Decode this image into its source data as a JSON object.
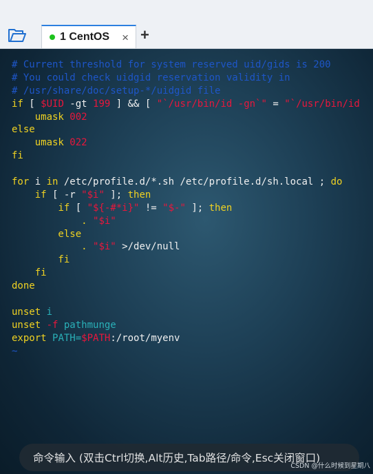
{
  "tabs": [
    {
      "index": "1",
      "label": "CentOS",
      "close": "×"
    }
  ],
  "new_tab_label": "+",
  "colors": {
    "comment": "#1e56c8",
    "keyword": "#f0d222",
    "variable": "#e8173c",
    "string": "#e8173c",
    "command": "#2ab0b8",
    "text": "#f0f0f0",
    "option": "#f0f0f0",
    "active_dot": "#1dc21d"
  },
  "terminal_lines": [
    [
      {
        "t": "# Current threshold for system reserved uid/gids is 200",
        "c": "comment"
      }
    ],
    [
      {
        "t": "# You could check uidgid reservation validity in",
        "c": "comment"
      }
    ],
    [
      {
        "t": "# /usr/share/doc/setup-*/uidgid file",
        "c": "comment"
      }
    ],
    [
      {
        "t": "if",
        "c": "keyword"
      },
      {
        "t": " [ ",
        "c": "text"
      },
      {
        "t": "$UID",
        "c": "variable"
      },
      {
        "t": " -gt ",
        "c": "text"
      },
      {
        "t": "199",
        "c": "variable"
      },
      {
        "t": " ] && [ ",
        "c": "text"
      },
      {
        "t": "\"`/usr/bin/id -gn`\"",
        "c": "string"
      },
      {
        "t": " = ",
        "c": "text"
      },
      {
        "t": "\"`/usr/bin/id",
        "c": "string"
      }
    ],
    [
      {
        "t": "    umask ",
        "c": "keyword"
      },
      {
        "t": "002",
        "c": "variable"
      }
    ],
    [
      {
        "t": "else",
        "c": "keyword"
      }
    ],
    [
      {
        "t": "    umask ",
        "c": "keyword"
      },
      {
        "t": "022",
        "c": "variable"
      }
    ],
    [
      {
        "t": "fi",
        "c": "keyword"
      }
    ],
    [],
    [
      {
        "t": "for",
        "c": "keyword"
      },
      {
        "t": " i ",
        "c": "text"
      },
      {
        "t": "in",
        "c": "keyword"
      },
      {
        "t": " /etc/profile.d/*.sh /etc/profile.d/sh.local ; ",
        "c": "text"
      },
      {
        "t": "do",
        "c": "keyword"
      }
    ],
    [
      {
        "t": "    ",
        "c": "text"
      },
      {
        "t": "if",
        "c": "keyword"
      },
      {
        "t": " [ -r ",
        "c": "text"
      },
      {
        "t": "\"$i\"",
        "c": "string"
      },
      {
        "t": " ]; ",
        "c": "text"
      },
      {
        "t": "then",
        "c": "keyword"
      }
    ],
    [
      {
        "t": "        ",
        "c": "text"
      },
      {
        "t": "if",
        "c": "keyword"
      },
      {
        "t": " [ ",
        "c": "text"
      },
      {
        "t": "\"${-#*i}\"",
        "c": "string"
      },
      {
        "t": " != ",
        "c": "text"
      },
      {
        "t": "\"$-\"",
        "c": "string"
      },
      {
        "t": " ]; ",
        "c": "text"
      },
      {
        "t": "then",
        "c": "keyword"
      }
    ],
    [
      {
        "t": "            . ",
        "c": "keyword"
      },
      {
        "t": "\"$i\"",
        "c": "string"
      }
    ],
    [
      {
        "t": "        else",
        "c": "keyword"
      }
    ],
    [
      {
        "t": "            . ",
        "c": "keyword"
      },
      {
        "t": "\"$i\"",
        "c": "string"
      },
      {
        "t": " >/dev/null",
        "c": "text"
      }
    ],
    [
      {
        "t": "        fi",
        "c": "keyword"
      }
    ],
    [
      {
        "t": "    fi",
        "c": "keyword"
      }
    ],
    [
      {
        "t": "done",
        "c": "keyword"
      }
    ],
    [],
    [
      {
        "t": "unset ",
        "c": "keyword"
      },
      {
        "t": "i",
        "c": "command"
      }
    ],
    [
      {
        "t": "unset ",
        "c": "keyword"
      },
      {
        "t": "-f",
        "c": "variable"
      },
      {
        "t": " pathmunge",
        "c": "command"
      }
    ],
    [
      {
        "t": "export ",
        "c": "keyword"
      },
      {
        "t": "PATH=",
        "c": "command"
      },
      {
        "t": "$PATH",
        "c": "variable"
      },
      {
        "t": ":/root/myenv",
        "c": "text"
      }
    ],
    [
      {
        "t": "~",
        "c": "comment"
      }
    ]
  ],
  "command_bar": "命令输入 (双击Ctrl切换,Alt历史,Tab路径/命令,Esc关闭窗口)",
  "watermark": "CSDN @什么时候到星期八"
}
